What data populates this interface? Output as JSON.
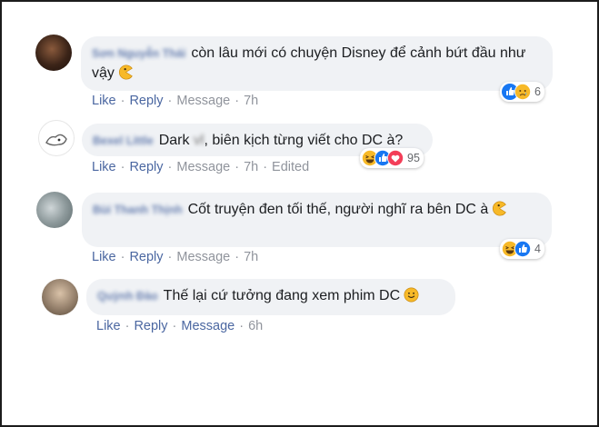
{
  "comments": [
    {
      "name": "Sơn Nguyễn Thái",
      "text": "còn lâu mới có chuyện Disney để cảnh bứt đầu như vậy",
      "like": "Like",
      "reply": "Reply",
      "message": "Message",
      "time": "7h",
      "edited": "",
      "reactions": [
        "like",
        "sad"
      ],
      "count": "6"
    },
    {
      "name": "Bexel Little",
      "text_before": "Dark",
      "text_blurred": "vl",
      "text_after": ", biên kịch từng viết cho DC à?",
      "like": "Like",
      "reply": "Reply",
      "message": "Message",
      "time": "7h",
      "edited": "Edited",
      "reactions": [
        "haha",
        "like",
        "love"
      ],
      "count": "95"
    },
    {
      "name": "Bùi Thanh Thịnh",
      "text": "Cốt truyện đen tối thế, người nghĩ ra bên DC à",
      "like": "Like",
      "reply": "Reply",
      "message": "Message",
      "time": "7h",
      "edited": "",
      "reactions": [
        "haha",
        "like"
      ],
      "count": "4"
    },
    {
      "name": "Quỳnh Đào",
      "text": "Thế lại cứ tưởng đang xem phim DC",
      "like": "Like",
      "reply": "Reply",
      "message": "Message",
      "time": "6h",
      "edited": "",
      "reactions": [],
      "count": ""
    }
  ],
  "colors": {
    "action_link": "#4b67a1",
    "meta_text": "#90949c",
    "bubble_bg": "#f0f2f5",
    "name": "#385898",
    "like_blue": "#1877f2",
    "love_red": "#f33e58",
    "emoji_yellow": "#f7b928"
  }
}
